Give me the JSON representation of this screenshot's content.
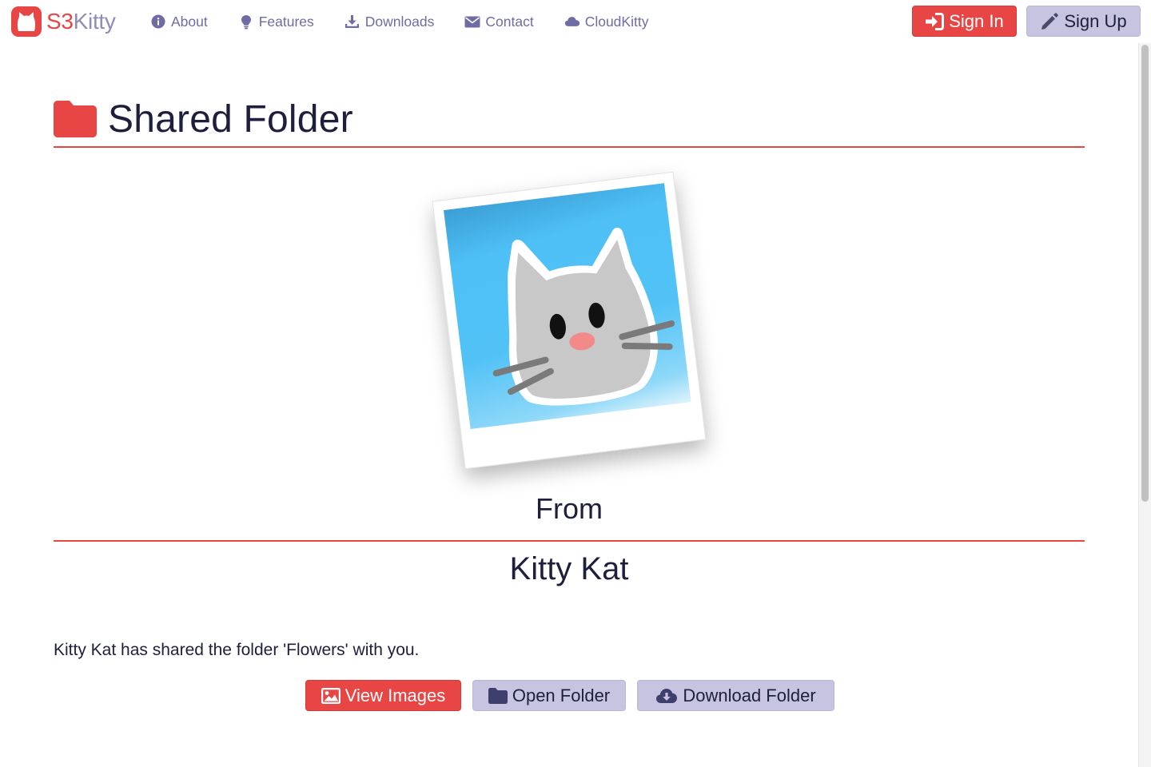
{
  "brand": {
    "part1": "S3",
    "part2": "Kitty"
  },
  "nav": [
    {
      "label": "About",
      "icon": "info-circle-icon"
    },
    {
      "label": "Features",
      "icon": "lightbulb-icon"
    },
    {
      "label": "Downloads",
      "icon": "download-icon"
    },
    {
      "label": "Contact",
      "icon": "envelope-icon"
    },
    {
      "label": "CloudKitty",
      "icon": "cloud-icon"
    }
  ],
  "auth": {
    "sign_in": "Sign In",
    "sign_up": "Sign Up"
  },
  "page": {
    "title": "Shared Folder",
    "from_label": "From",
    "sender": "Kitty Kat",
    "message": "Kitty Kat has shared the folder 'Flowers' with you."
  },
  "actions": {
    "view_images": "View Images",
    "open_folder": "Open Folder",
    "download_folder": "Download Folder"
  },
  "colors": {
    "accent_red": "#e84545",
    "lavender": "#c6c4e0",
    "nav_text": "#6e6ca3",
    "text_dark": "#1f1f3d"
  }
}
